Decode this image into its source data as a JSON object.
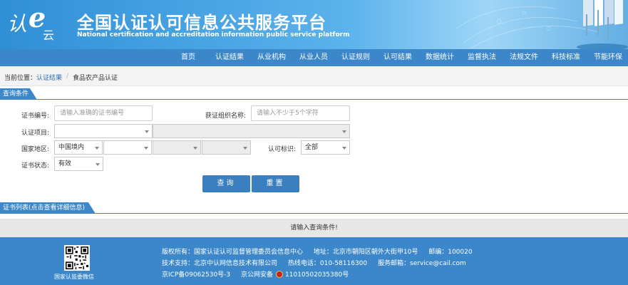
{
  "header": {
    "title_cn": "全国认证认可信息公共服务平台",
    "title_en": "National certification and accreditation information public service platform",
    "logo": {
      "ren": "认",
      "yun": "云"
    }
  },
  "nav": {
    "items": [
      "首页",
      "认证结果",
      "从业机构",
      "从业人员",
      "认证规则",
      "认可结果",
      "数据统计",
      "监督执法",
      "法规文件",
      "科技标准",
      "节能环保"
    ]
  },
  "breadcrumb": {
    "prefix": "当前位置：",
    "link": "认证结果",
    "sep": "/",
    "current": "食品农产品认证"
  },
  "query": {
    "section_title": "查询条件",
    "cert_no_label": "证书编号:",
    "cert_no_placeholder": "请输入准确的证书编号",
    "org_label": "获证组织名称:",
    "org_placeholder": "请输入不少于5个字符",
    "project_label": "认证项目:",
    "region_label": "国家地区:",
    "region_value": "中国境内",
    "mark_label": "认可标识:",
    "mark_value": "全部",
    "status_label": "证书状态:",
    "status_value": "有效",
    "search_button": "查询",
    "reset_button": "重置"
  },
  "list": {
    "section_title": "证书列表(点击查看详细信息)",
    "empty_message": "请输入查询条件!"
  },
  "footer": {
    "qr_caption": "国家认监委微信",
    "line1_a": "版权所有：国家认证认可监督管理委员会信息中心",
    "line1_b": "地址：北京市朝阳区朝外大街甲10号",
    "line1_c": "邮编：100020",
    "line2_a": "技术支持：北京中认网信息技术有限公司",
    "line2_b": "热线电话：010-58116300",
    "line2_c": "服务邮箱：service@cail.com",
    "line3_a": "京ICP备09062530号-3",
    "line3_b": "京公网安备",
    "line3_c": "11010502035380号"
  },
  "colors": {
    "brand_blue": "#3b87c9",
    "button_blue": "#3a7fc0"
  }
}
